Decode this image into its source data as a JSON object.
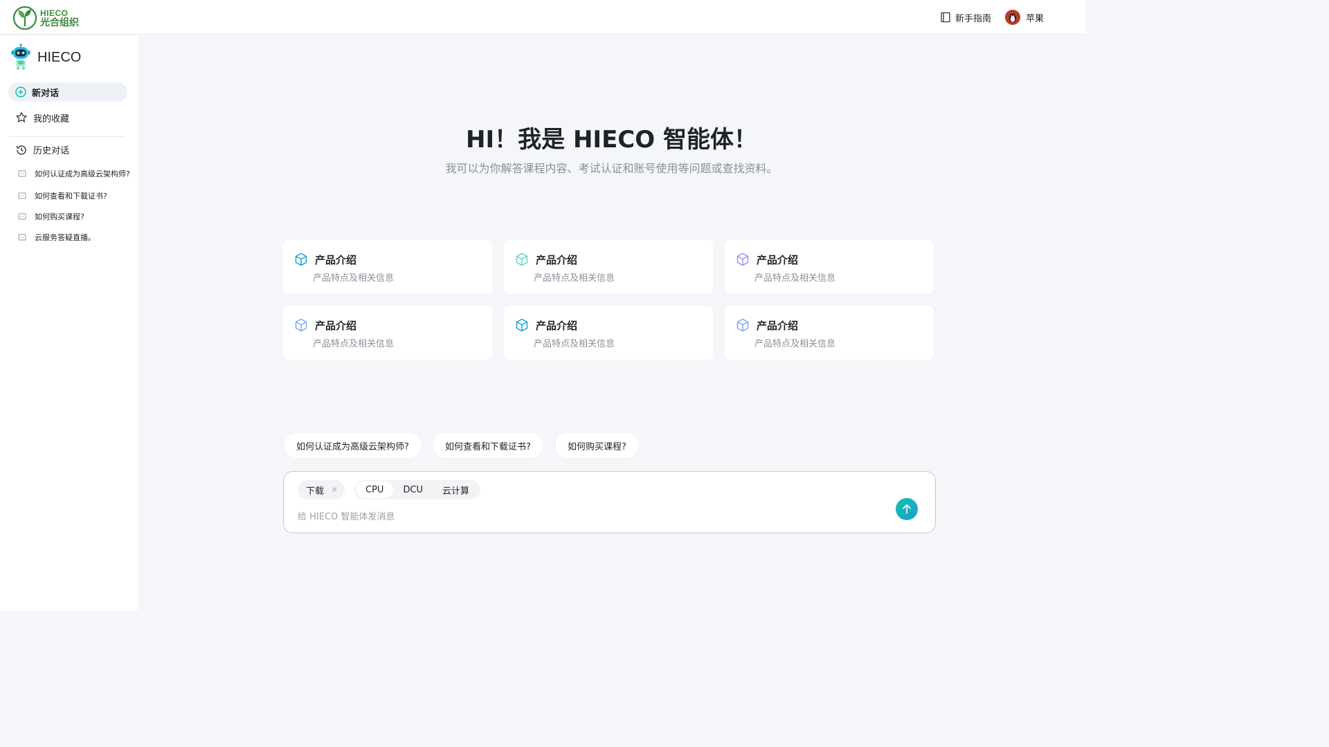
{
  "header": {
    "logo_en": "HIECO",
    "logo_cn": "光合组织",
    "guide_label": "新手指南",
    "user_name": "苹果"
  },
  "sidebar": {
    "brand": "HIECO",
    "new_chat": "新对话",
    "favorites": "我的收藏",
    "history_title": "历史对话",
    "history": [
      "如何认证成为高级云架构师?",
      "如何查看和下载证书?",
      "如何购买课程?",
      "云服务答疑直播。"
    ]
  },
  "main": {
    "title": "HI！我是 HIECO 智能体！",
    "subtitle": "我可以为你解答课程内容、考试认证和账号使用等问题或查找资料。",
    "cards": [
      {
        "title": "产品介绍",
        "desc": "产品特点及相关信息",
        "icon_color": "#1a9fd0"
      },
      {
        "title": "产品介绍",
        "desc": "产品特点及相关信息",
        "icon_color": "#5fd3c8"
      },
      {
        "title": "产品介绍",
        "desc": "产品特点及相关信息",
        "icon_color": "#a58cf0"
      },
      {
        "title": "产品介绍",
        "desc": "产品特点及相关信息",
        "icon_color": "#7fa8f0"
      },
      {
        "title": "产品介绍",
        "desc": "产品特点及相关信息",
        "icon_color": "#1a9fd0"
      },
      {
        "title": "产品介绍",
        "desc": "产品特点及相关信息",
        "icon_color": "#7fa8f0"
      }
    ],
    "suggestions": [
      "如何认证成为高级云架构师?",
      "如何查看和下载证书?",
      "如何购买课程?"
    ]
  },
  "composer": {
    "tag": "下载",
    "segments": [
      "CPU",
      "DCU",
      "云计算"
    ],
    "selected_segment": "CPU",
    "placeholder": "给 HIECO 智能体发消息"
  },
  "colors": {
    "accent": "#16c0b0",
    "brand_green": "#3a8a3d"
  }
}
